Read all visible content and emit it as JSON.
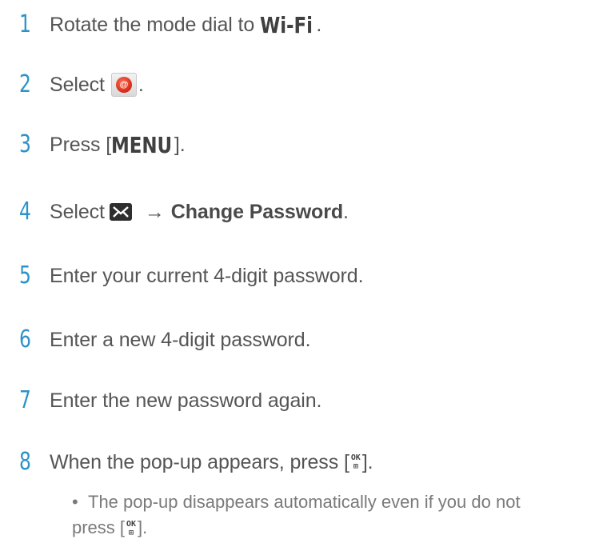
{
  "steps": [
    {
      "num": "1",
      "pre": "Rotate the mode dial to ",
      "strong": "Wi-Fi",
      "post": "."
    },
    {
      "num": "2",
      "pre": "Select",
      "icon": "email-app-icon",
      "post": "."
    },
    {
      "num": "3",
      "pre": "Press [",
      "strong": "MENU",
      "post": "]."
    },
    {
      "num": "4",
      "pre": "Select",
      "icon": "envelope-icon",
      "arrow": "→",
      "bold": "Change Password",
      "post": "."
    },
    {
      "num": "5",
      "text": "Enter your current 4-digit password."
    },
    {
      "num": "6",
      "text": "Enter a new 4-digit password."
    },
    {
      "num": "7",
      "text": "Enter the new password again."
    },
    {
      "num": "8",
      "pre": "When the pop-up appears, press [",
      "icon": "ok-button-icon",
      "post": "]."
    }
  ],
  "note": {
    "bullet": "•",
    "line1": "The pop-up disappears automatically even if you do not",
    "line2_pre": "press [",
    "line2_post": "]."
  },
  "ok_glyph": {
    "top": "OK",
    "bottom": "⊞"
  },
  "colors": {
    "step_number": "#2b93c8",
    "body_text": "#555555"
  }
}
